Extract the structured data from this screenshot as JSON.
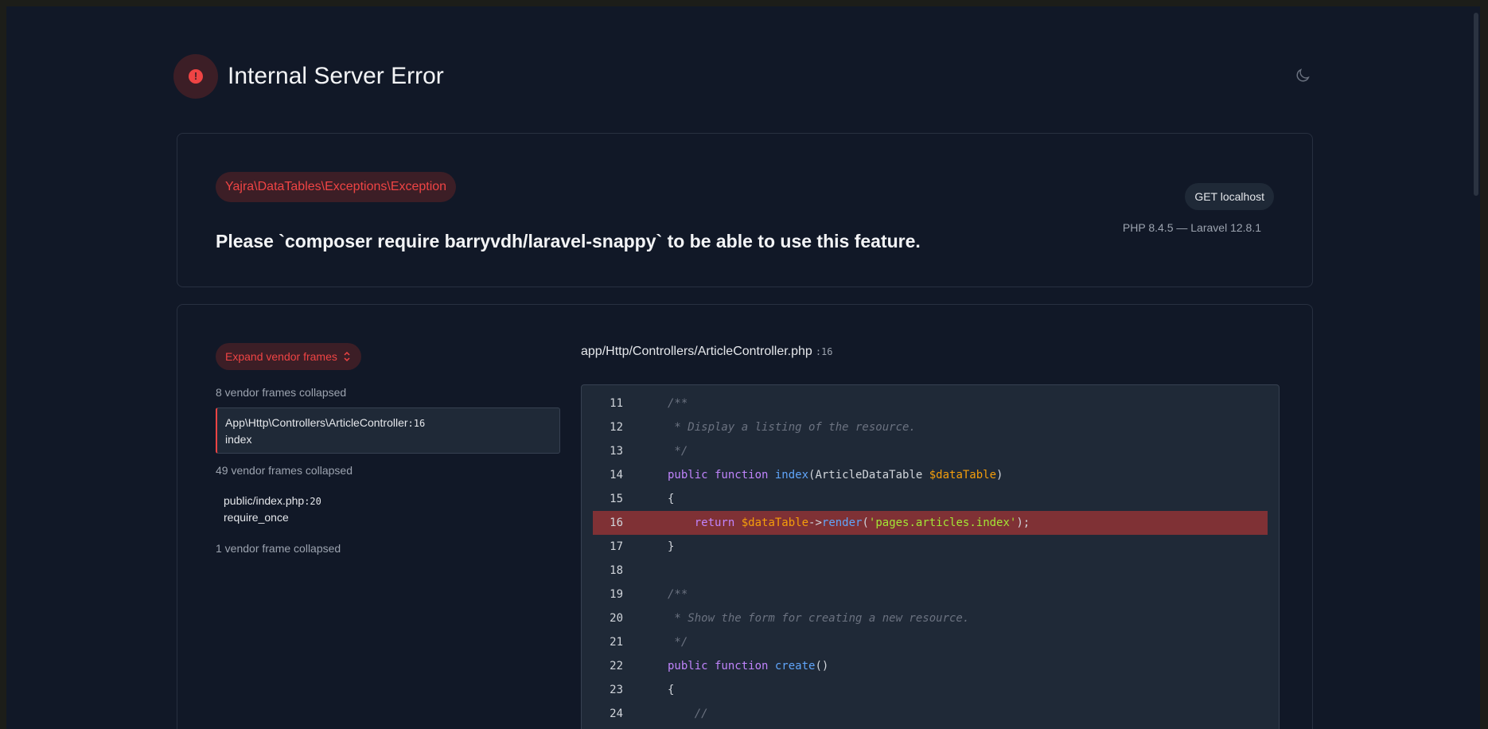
{
  "page": {
    "title": "Internal Server Error",
    "icons": {
      "error": "exclamation-circle-icon",
      "theme": "moon-icon"
    }
  },
  "exception": {
    "class": "Yajra\\DataTables\\Exceptions\\Exception",
    "message": "Please `composer require barryvdh/laravel-snappy` to be able to use this feature.",
    "request": "GET localhost",
    "versions": "PHP 8.4.5 — Laravel 12.8.1"
  },
  "trace": {
    "expand_label": "Expand vendor frames",
    "collapsed": [
      "8 vendor frames collapsed",
      "49 vendor frames collapsed",
      "1 vendor frame collapsed"
    ],
    "frames": [
      {
        "class": "App\\Http\\Controllers\\ArticleController",
        "line": ":16",
        "method": "index"
      },
      {
        "class": "public/index.php",
        "line": ":20",
        "method": "require_once"
      }
    ]
  },
  "code": {
    "file": "app/Http/Controllers/ArticleController.php",
    "line": ":16",
    "highlight_line": "16",
    "lines": [
      {
        "n": "11",
        "parts": [
          {
            "t": "    /**",
            "c": "c-comment"
          }
        ]
      },
      {
        "n": "12",
        "parts": [
          {
            "t": "     * Display a listing of the resource.",
            "c": "c-comment"
          }
        ]
      },
      {
        "n": "13",
        "parts": [
          {
            "t": "     */",
            "c": "c-comment"
          }
        ]
      },
      {
        "n": "14",
        "parts": [
          {
            "t": "    ",
            "c": "c-plain"
          },
          {
            "t": "public function ",
            "c": "c-kw"
          },
          {
            "t": "index",
            "c": "c-fn"
          },
          {
            "t": "(ArticleDataTable ",
            "c": "c-plain"
          },
          {
            "t": "$dataTable",
            "c": "c-var"
          },
          {
            "t": ")",
            "c": "c-plain"
          }
        ]
      },
      {
        "n": "15",
        "parts": [
          {
            "t": "    {",
            "c": "c-plain"
          }
        ]
      },
      {
        "n": "16",
        "parts": [
          {
            "t": "        ",
            "c": "c-plain"
          },
          {
            "t": "return ",
            "c": "c-kw"
          },
          {
            "t": "$dataTable",
            "c": "c-var"
          },
          {
            "t": "->",
            "c": "c-plain"
          },
          {
            "t": "render",
            "c": "c-fn"
          },
          {
            "t": "(",
            "c": "c-plain"
          },
          {
            "t": "'pages.articles.index'",
            "c": "c-str"
          },
          {
            "t": ");",
            "c": "c-plain"
          }
        ]
      },
      {
        "n": "17",
        "parts": [
          {
            "t": "    }",
            "c": "c-plain"
          }
        ]
      },
      {
        "n": "18",
        "parts": [
          {
            "t": "",
            "c": "c-plain"
          }
        ]
      },
      {
        "n": "19",
        "parts": [
          {
            "t": "    /**",
            "c": "c-comment"
          }
        ]
      },
      {
        "n": "20",
        "parts": [
          {
            "t": "     * Show the form for creating a new resource.",
            "c": "c-comment"
          }
        ]
      },
      {
        "n": "21",
        "parts": [
          {
            "t": "     */",
            "c": "c-comment"
          }
        ]
      },
      {
        "n": "22",
        "parts": [
          {
            "t": "    ",
            "c": "c-plain"
          },
          {
            "t": "public function ",
            "c": "c-kw"
          },
          {
            "t": "create",
            "c": "c-fn"
          },
          {
            "t": "()",
            "c": "c-plain"
          }
        ]
      },
      {
        "n": "23",
        "parts": [
          {
            "t": "    {",
            "c": "c-plain"
          }
        ]
      },
      {
        "n": "24",
        "parts": [
          {
            "t": "        //",
            "c": "c-comment"
          }
        ]
      }
    ]
  }
}
